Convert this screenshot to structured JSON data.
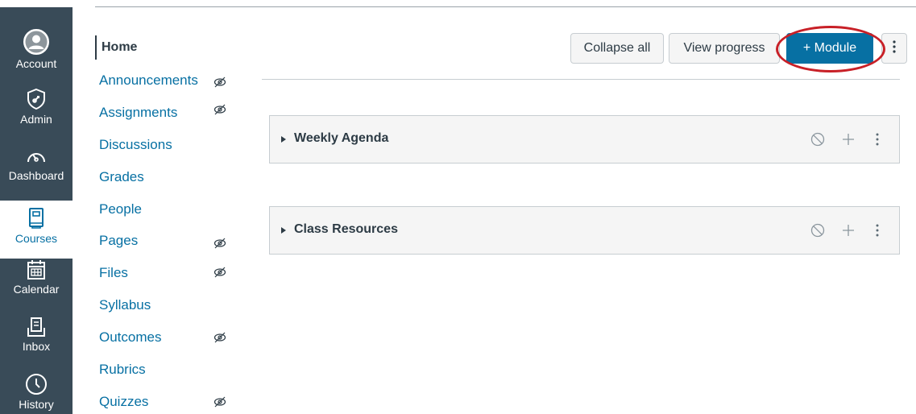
{
  "global_nav": [
    {
      "label": "Account",
      "icon": "account-avatar-icon"
    },
    {
      "label": "Admin",
      "icon": "admin-shield-icon"
    },
    {
      "label": "Dashboard",
      "icon": "dashboard-speedometer-icon"
    },
    {
      "label": "Courses",
      "icon": "courses-book-icon",
      "active": true
    },
    {
      "label": "Calendar",
      "icon": "calendar-icon"
    },
    {
      "label": "Inbox",
      "icon": "inbox-icon"
    },
    {
      "label": "History",
      "icon": "history-clock-icon"
    }
  ],
  "course_nav": [
    {
      "label": "Home",
      "active": true,
      "hidden": false
    },
    {
      "label": "Announcements",
      "hidden": true
    },
    {
      "label": "Assignments",
      "hidden": true
    },
    {
      "label": "Discussions",
      "hidden": false
    },
    {
      "label": "Grades",
      "hidden": false
    },
    {
      "label": "People",
      "hidden": false
    },
    {
      "label": "Pages",
      "hidden": true
    },
    {
      "label": "Files",
      "hidden": true
    },
    {
      "label": "Syllabus",
      "hidden": false
    },
    {
      "label": "Outcomes",
      "hidden": true
    },
    {
      "label": "Rubrics",
      "hidden": false
    },
    {
      "label": "Quizzes",
      "hidden": true
    }
  ],
  "header": {
    "collapse_all": "Collapse all",
    "view_progress": "View progress",
    "add_module": "+ Module"
  },
  "modules": [
    {
      "title": "Weekly Agenda"
    },
    {
      "title": "Class Resources"
    }
  ],
  "colors": {
    "nav_bg": "#394b58",
    "link": "#0770a3",
    "primary_button": "#0770a3",
    "highlight_ring": "#c82027"
  }
}
